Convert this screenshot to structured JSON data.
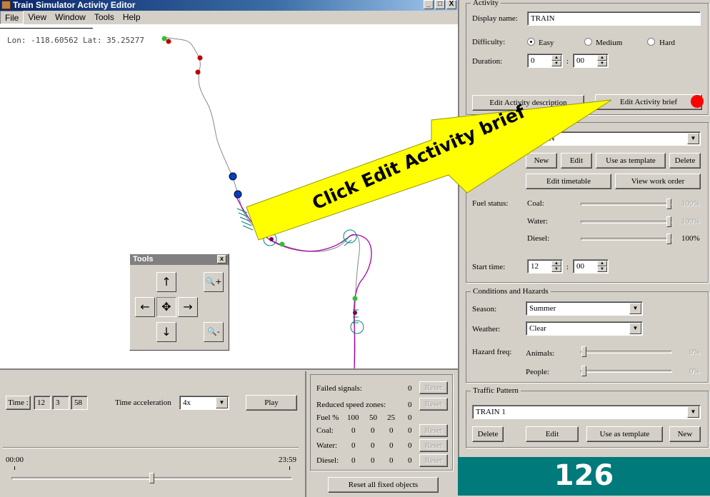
{
  "window": {
    "title": "Train Simulator Activity Editor",
    "minimize": "_",
    "maximize": "□",
    "close": "X"
  },
  "menu": [
    "File",
    "View",
    "Window",
    "Tools",
    "Help"
  ],
  "map": {
    "coords": "Lon: -118.60562 Lat: 35.25277"
  },
  "tools": {
    "title": "Tools",
    "close": "x",
    "up": "↑",
    "down": "↓",
    "left": "←",
    "right": "→",
    "center": "✥",
    "zoom_in": "🔍+",
    "zoom_out": "🔍-"
  },
  "time": {
    "label": "Time :",
    "h": "12",
    "m": "3",
    "s": "58",
    "accel_label": "Time acceleration",
    "accel": "4x",
    "play": "Play",
    "start": "00:00",
    "end": "23:59"
  },
  "status": {
    "failed_signals": "Failed signals:",
    "failed_signals_val": "0",
    "reduced": "Reduced speed zones:",
    "reduced_val": "0",
    "fuel_hdr": "Fuel %",
    "fuel_cols": [
      "100",
      "50",
      "25",
      "0"
    ],
    "rows": [
      {
        "label": "Coal:",
        "vals": [
          "0",
          "0",
          "0",
          "0"
        ]
      },
      {
        "label": "Water:",
        "vals": [
          "0",
          "0",
          "0",
          "0"
        ]
      },
      {
        "label": "Diesel:",
        "vals": [
          "0",
          "0",
          "0",
          "0"
        ]
      }
    ],
    "reset": "Reset",
    "reset_all": "Reset all fixed objects"
  },
  "activity": {
    "group": "Activity",
    "display_name_label": "Display name:",
    "display_name": "TRAIN",
    "difficulty_label": "Difficulty:",
    "easy": "Easy",
    "medium": "Medium",
    "hard": "Hard",
    "duration_label": "Duration:",
    "dur_h": "0",
    "dur_m": "00",
    "edit_desc": "Edit Activity description",
    "edit_brief": "Edit Activity brief"
  },
  "player": {
    "service": "TRAIN",
    "new": "New",
    "edit": "Edit",
    "template": "Use as template",
    "delete": "Delete",
    "timetable": "Edit timetable",
    "work_order": "View work order",
    "fuel_label": "Fuel status:",
    "coal": "Coal:",
    "water": "Water:",
    "diesel": "Diesel:",
    "coal_pct": "100%",
    "water_pct": "100%",
    "diesel_pct": "100%",
    "coal_level": 1.0,
    "water_level": 1.0,
    "diesel_level": 1.0,
    "start_label": "Start time:",
    "start_h": "12",
    "start_m": "00"
  },
  "conditions": {
    "group": "Conditions and Hazards",
    "season_label": "Season:",
    "season": "Summer",
    "weather_label": "Weather:",
    "weather": "Clear",
    "hazard_label": "Hazard freq:",
    "animals": "Animals:",
    "people": "People:",
    "animals_pct": "0%",
    "people_pct": "0%",
    "animals_level": 0,
    "people_level": 0
  },
  "traffic": {
    "group": "Traffic Pattern",
    "pattern": "TRAIN 1",
    "delete": "Delete",
    "edit": "Edit",
    "template": "Use as template",
    "new": "New"
  },
  "callout": {
    "text": "Click Edit Activity brief",
    "color": "#ffff00",
    "marker": "#ff0000"
  },
  "page_number": "126",
  "colors": {
    "track": "#888888",
    "path": "#aa00aa",
    "teal": "#008080"
  }
}
